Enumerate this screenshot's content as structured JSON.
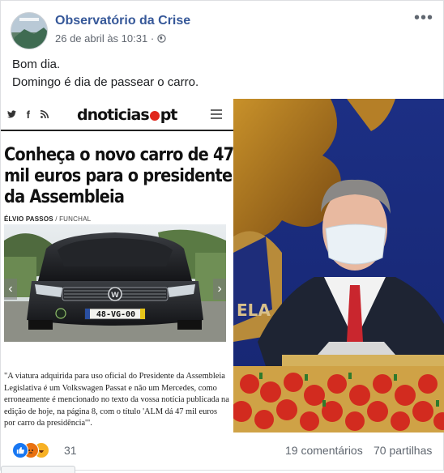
{
  "post": {
    "page_name": "Observatório da Crise",
    "timestamp": "26 de abril às 10:31",
    "dot": "·",
    "audience_icon": "globe-icon",
    "more_label": "•••",
    "text_line1": "Bom dia.",
    "text_line2": "Domingo é dia de passear o carro."
  },
  "article": {
    "social_icons": [
      "twitter-icon",
      "facebook-icon",
      "rss-icon"
    ],
    "social_glyphs": [
      "🐦",
      "f",
      "⁂"
    ],
    "logo_left": "dnoticias",
    "logo_right": "pt",
    "headline": "Conheça o novo carro de 47 mil euros para o presidente da Assembleia",
    "byline_author": "ÉLVIO PASSOS",
    "byline_place": "FUNCHAL",
    "byline_sep": " / ",
    "plate": "48-VG-00",
    "prev_arrow": "‹",
    "next_arrow": "›",
    "quote": "\"A viatura adquirida para uso oficial do Presidente da Assembleia Legislativa é um Volkswagen Passat e não um Mercedes, como erroneamente é mencionado no texto da vossa notícia publicada na edição de hoje, na página 8, com o título 'ALM dá 47 mil euros por carro da presidência'\"."
  },
  "photo2": {
    "banner_text": "ELA"
  },
  "footer": {
    "reaction_icons": [
      "like-icon",
      "angry-icon",
      "haha-icon"
    ],
    "reaction_count": "31",
    "comments": "19 comentários",
    "shares": "70 partilhas"
  }
}
